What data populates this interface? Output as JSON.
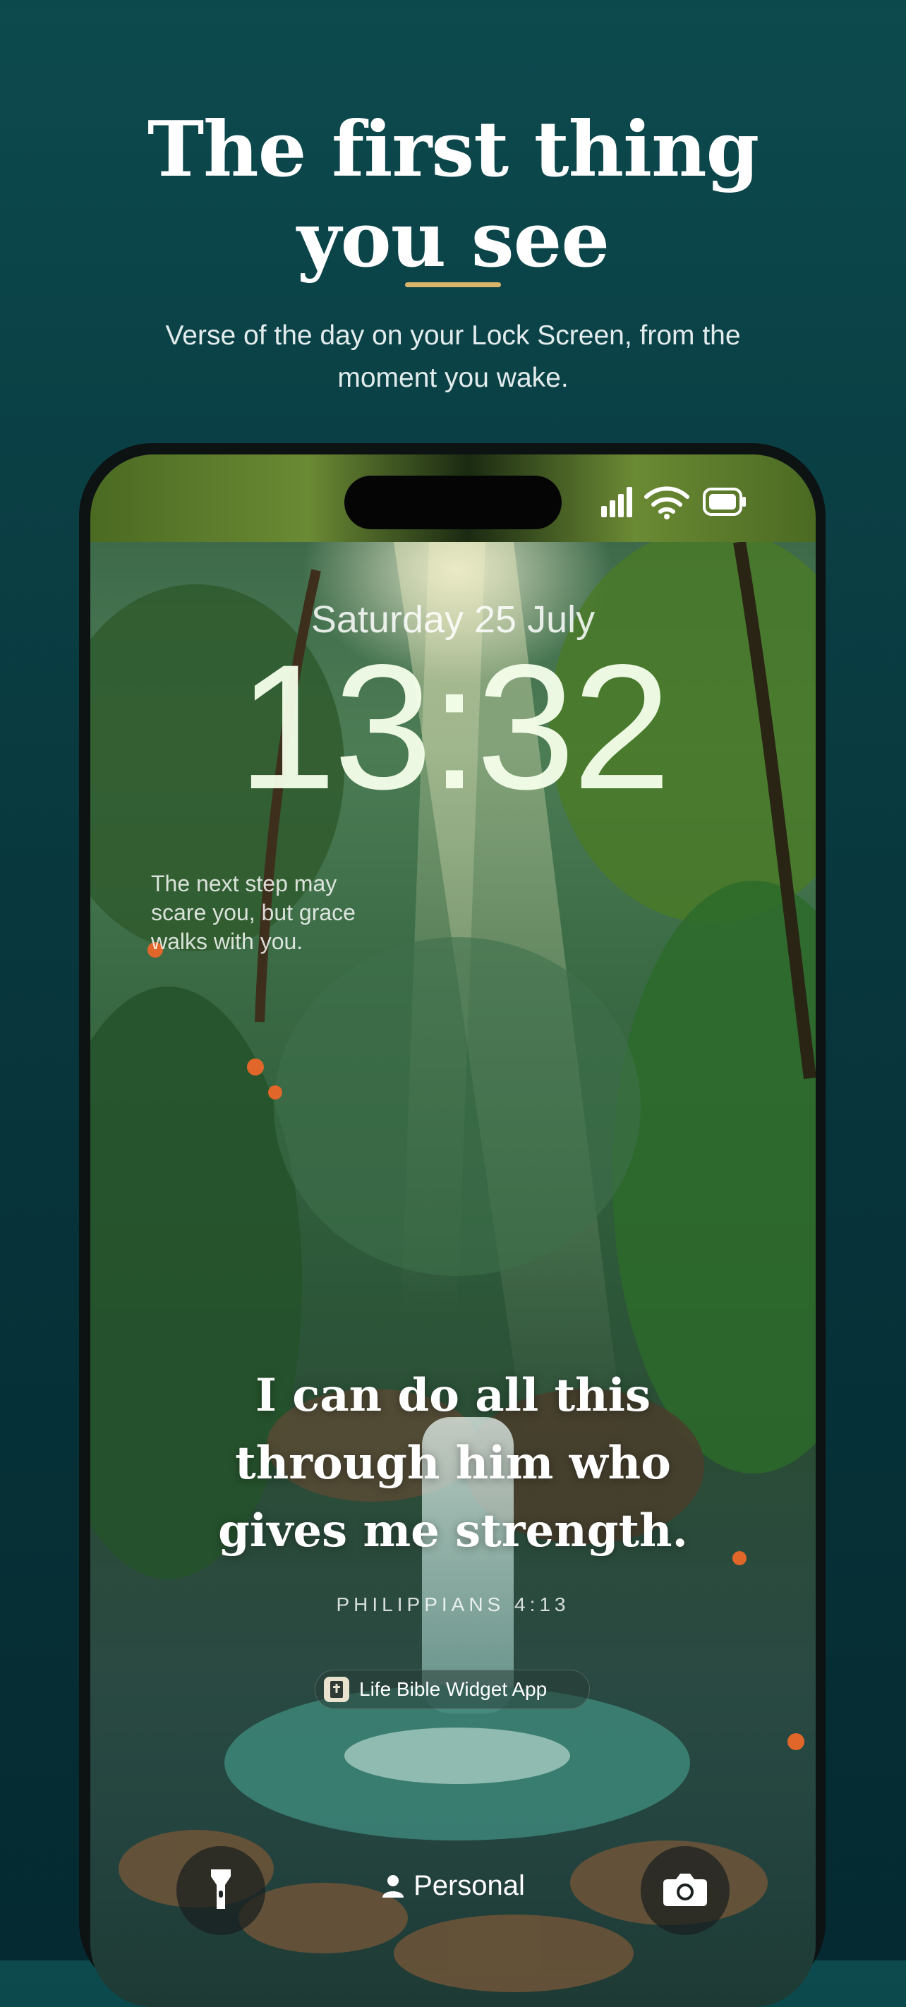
{
  "hero": {
    "title_line1": "The first thing",
    "title_line2": "you see",
    "subtitle_line1": "Verse of the day on your Lock Screen, from the",
    "subtitle_line2": "moment you wake."
  },
  "phone": {
    "status_icons": [
      "cellular-signal-icon",
      "wifi-icon",
      "battery-icon"
    ],
    "lock_screen": {
      "date": "Saturday 25 July",
      "time": "13:32",
      "widget_text": [
        "The next step may",
        "scare you, but grace",
        "walks with you."
      ],
      "verse_lines": [
        "I can do all this",
        "through him who",
        "gives me strength."
      ],
      "reference": "PHILIPPIANS 4:13",
      "app_badge": "Life Bible Widget App",
      "focus_mode": "Personal",
      "flashlight_icon": "flashlight-icon",
      "camera_icon": "camera-icon"
    }
  },
  "colors": {
    "background_top": "#0c4a4e",
    "background_bottom": "#052a31",
    "accent_underline": "#d9b56b"
  }
}
